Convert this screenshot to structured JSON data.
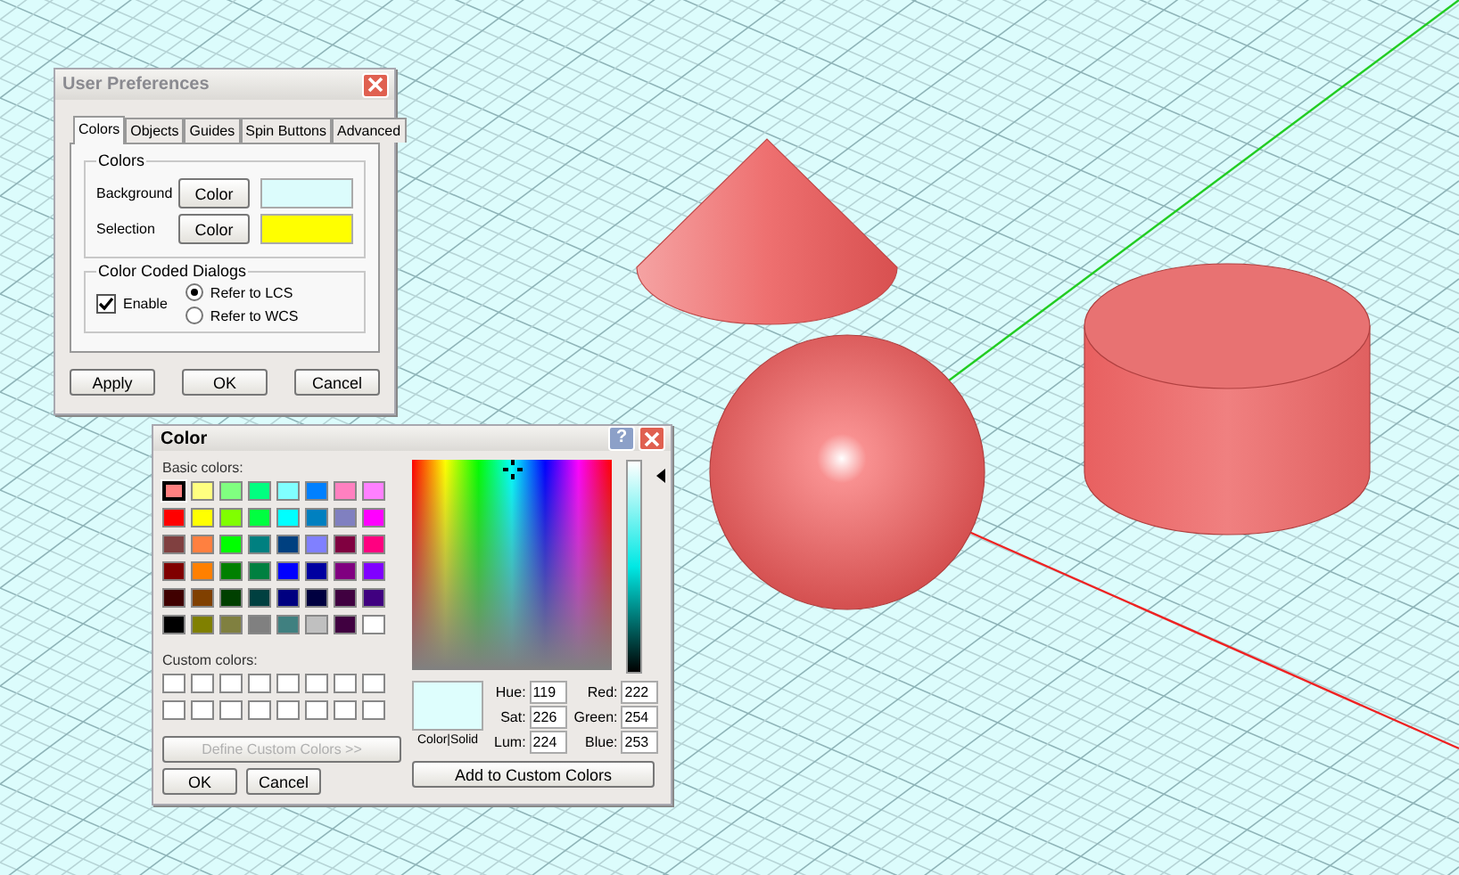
{
  "preferences": {
    "title": "User Preferences",
    "tabs": [
      {
        "label": "Colors",
        "selected": true
      },
      {
        "label": "Objects",
        "selected": false
      },
      {
        "label": "Guides",
        "selected": false
      },
      {
        "label": "Spin Buttons",
        "selected": false
      },
      {
        "label": "Advanced",
        "selected": false
      }
    ],
    "colors_group": {
      "title": "Colors",
      "rows": [
        {
          "label": "Background",
          "button": "Color",
          "color": "#dcfcfc"
        },
        {
          "label": "Selection",
          "button": "Color",
          "color": "#ffff00"
        }
      ]
    },
    "coded_group": {
      "title": "Color Coded Dialogs",
      "enable": {
        "label": "Enable",
        "checked": true
      },
      "options": [
        {
          "label": "Refer to LCS",
          "selected": true
        },
        {
          "label": "Refer to WCS",
          "selected": false
        }
      ]
    },
    "buttons": [
      "Apply",
      "OK",
      "Cancel"
    ]
  },
  "color_dialog": {
    "title": "Color",
    "help": "?",
    "basic_label": "Basic colors:",
    "basic_colors": [
      {
        "color": "#ff8080",
        "selected": true
      },
      {
        "color": "#ffff80",
        "selected": false
      },
      {
        "color": "#80ff80",
        "selected": false
      },
      {
        "color": "#00ff80",
        "selected": false
      },
      {
        "color": "#80ffff",
        "selected": false
      },
      {
        "color": "#0080ff",
        "selected": false
      },
      {
        "color": "#ff80c0",
        "selected": false
      },
      {
        "color": "#ff80ff",
        "selected": false
      },
      {
        "color": "#ff0000",
        "selected": false
      },
      {
        "color": "#ffff00",
        "selected": false
      },
      {
        "color": "#80ff00",
        "selected": false
      },
      {
        "color": "#00ff40",
        "selected": false
      },
      {
        "color": "#00ffff",
        "selected": false
      },
      {
        "color": "#0080c0",
        "selected": false
      },
      {
        "color": "#8080c0",
        "selected": false
      },
      {
        "color": "#ff00ff",
        "selected": false
      },
      {
        "color": "#804040",
        "selected": false
      },
      {
        "color": "#ff8040",
        "selected": false
      },
      {
        "color": "#00ff00",
        "selected": false
      },
      {
        "color": "#008080",
        "selected": false
      },
      {
        "color": "#004080",
        "selected": false
      },
      {
        "color": "#8080ff",
        "selected": false
      },
      {
        "color": "#800040",
        "selected": false
      },
      {
        "color": "#ff0080",
        "selected": false
      },
      {
        "color": "#800000",
        "selected": false
      },
      {
        "color": "#ff8000",
        "selected": false
      },
      {
        "color": "#008000",
        "selected": false
      },
      {
        "color": "#008040",
        "selected": false
      },
      {
        "color": "#0000ff",
        "selected": false
      },
      {
        "color": "#0000a0",
        "selected": false
      },
      {
        "color": "#800080",
        "selected": false
      },
      {
        "color": "#8000ff",
        "selected": false
      },
      {
        "color": "#400000",
        "selected": false
      },
      {
        "color": "#804000",
        "selected": false
      },
      {
        "color": "#004000",
        "selected": false
      },
      {
        "color": "#004040",
        "selected": false
      },
      {
        "color": "#000080",
        "selected": false
      },
      {
        "color": "#000040",
        "selected": false
      },
      {
        "color": "#400040",
        "selected": false
      },
      {
        "color": "#400080",
        "selected": false
      },
      {
        "color": "#000000",
        "selected": false
      },
      {
        "color": "#808000",
        "selected": false
      },
      {
        "color": "#808040",
        "selected": false
      },
      {
        "color": "#808080",
        "selected": false
      },
      {
        "color": "#408080",
        "selected": false
      },
      {
        "color": "#c0c0c0",
        "selected": false
      },
      {
        "color": "#400040",
        "selected": false
      },
      {
        "color": "#ffffff",
        "selected": false
      }
    ],
    "custom_label": "Custom colors:",
    "custom_colors": [
      {
        "color": "#ffffff"
      },
      {
        "color": "#ffffff"
      },
      {
        "color": "#ffffff"
      },
      {
        "color": "#ffffff"
      },
      {
        "color": "#ffffff"
      },
      {
        "color": "#ffffff"
      },
      {
        "color": "#ffffff"
      },
      {
        "color": "#ffffff"
      },
      {
        "color": "#ffffff"
      },
      {
        "color": "#ffffff"
      },
      {
        "color": "#ffffff"
      },
      {
        "color": "#ffffff"
      },
      {
        "color": "#ffffff"
      },
      {
        "color": "#ffffff"
      },
      {
        "color": "#ffffff"
      },
      {
        "color": "#ffffff"
      }
    ],
    "define_button": {
      "label": "Define Custom Colors >>",
      "disabled": true
    },
    "buttons": [
      "OK",
      "Cancel"
    ],
    "preview_label": "Color|Solid",
    "fields": [
      {
        "label": "Hue:",
        "value": "119"
      },
      {
        "label": "Red:",
        "value": "222"
      },
      {
        "label": "Sat:",
        "value": "226"
      },
      {
        "label": "Green:",
        "value": "254"
      },
      {
        "label": "Lum:",
        "value": "224"
      },
      {
        "label": "Blue:",
        "value": "253"
      }
    ],
    "add_button": "Add to Custom Colors"
  }
}
